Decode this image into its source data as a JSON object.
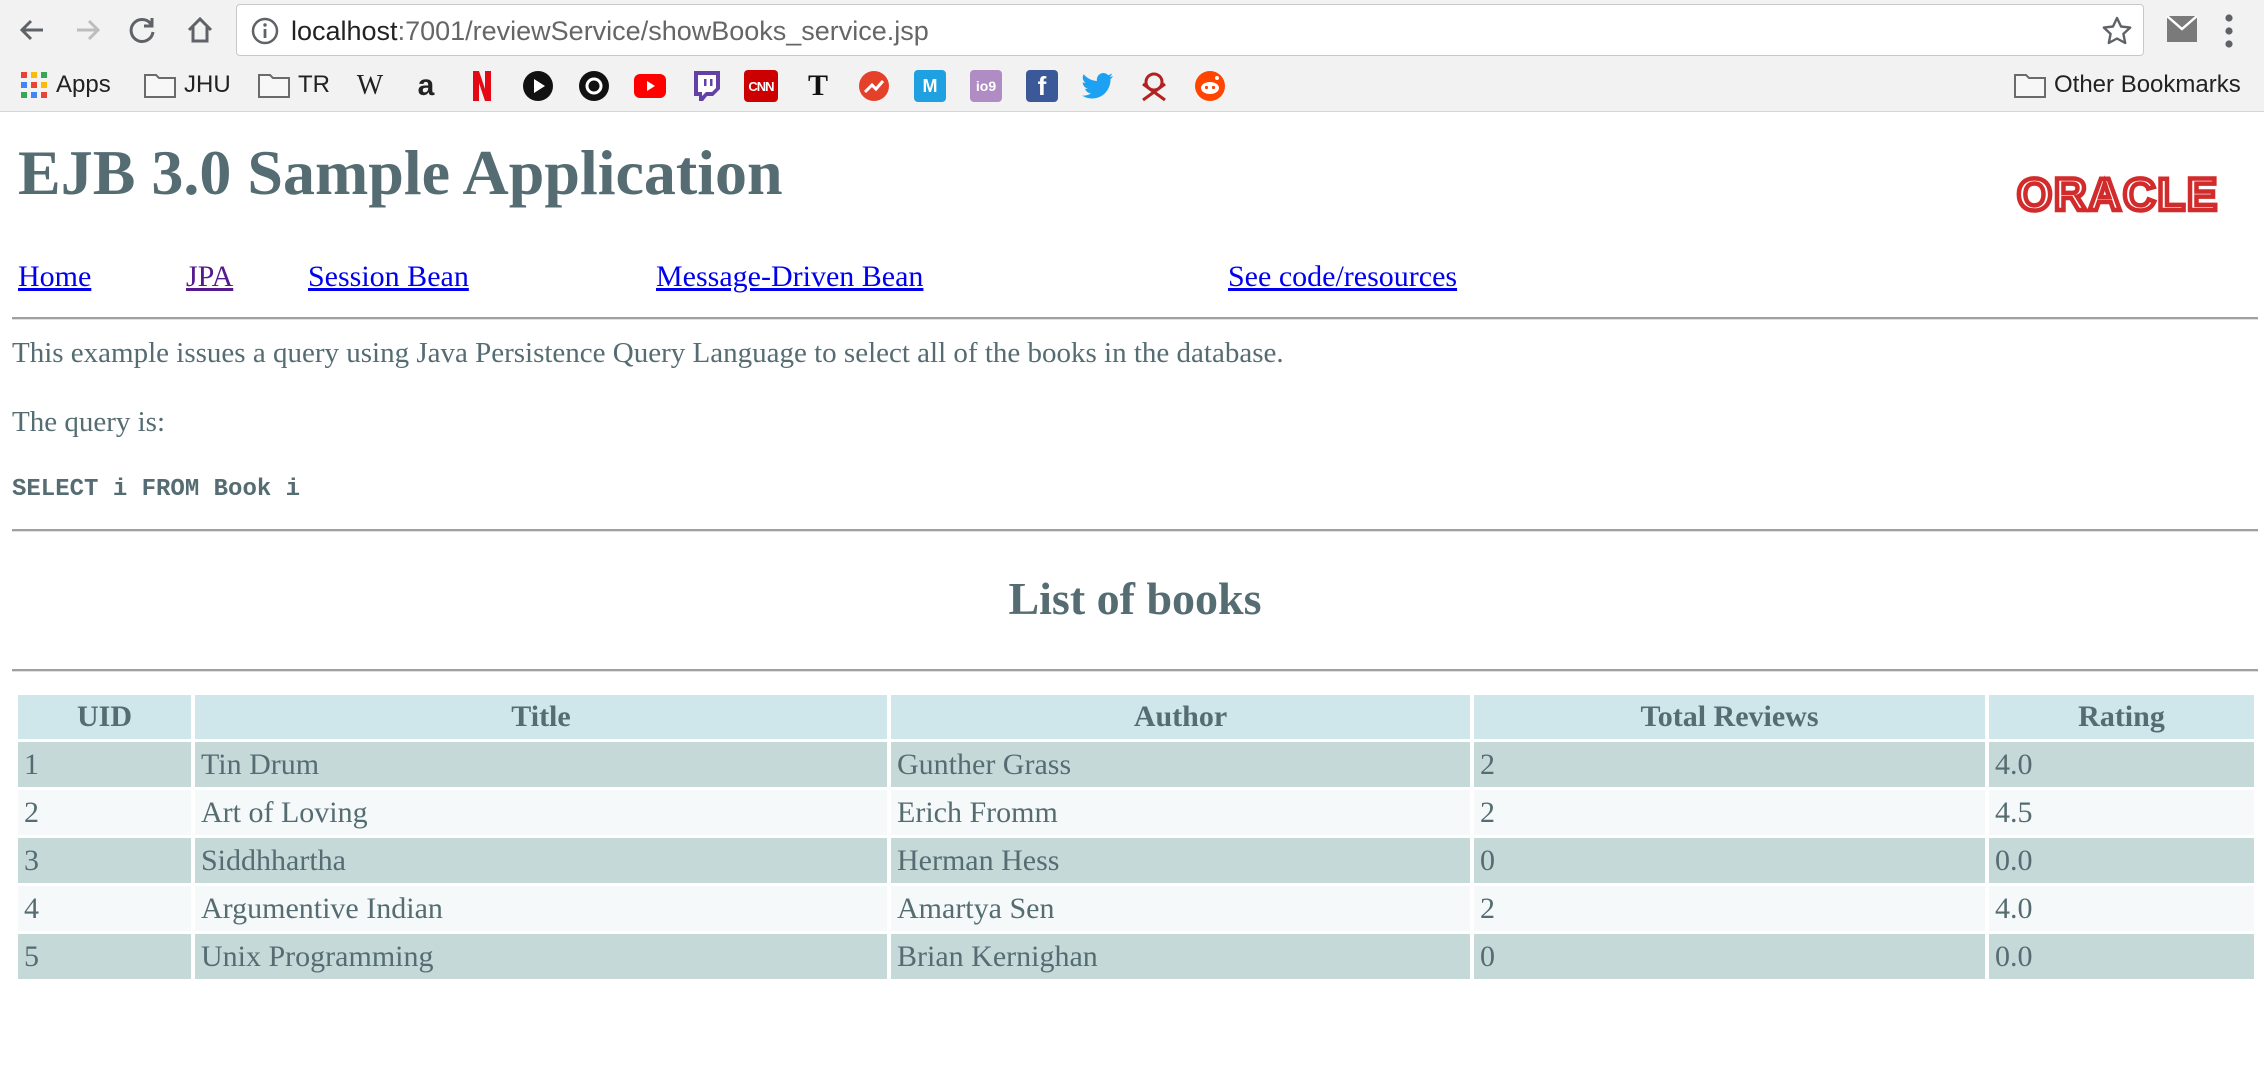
{
  "browser": {
    "url_host": "localhost",
    "url_rest": ":7001/reviewService/showBooks_service.jsp"
  },
  "bookmarks": {
    "apps": "Apps",
    "folders": [
      "JHU",
      "TR"
    ],
    "other": "Other Bookmarks"
  },
  "page": {
    "title": "EJB 3.0 Sample Application",
    "logo_text": "ORACLE",
    "nav": [
      "Home",
      "JPA",
      "Session Bean",
      "Message-Driven Bean",
      "See code/resources"
    ],
    "intro": "This example issues a query using Java Persistence Query Language to select all of the books in the database.",
    "query_label": "The query is:",
    "query": "SELECT i FROM Book i",
    "list_title": "List of books"
  },
  "table": {
    "headers": [
      "UID",
      "Title",
      "Author",
      "Total Reviews",
      "Rating"
    ],
    "rows": [
      [
        "1",
        "Tin Drum",
        "Gunther Grass",
        "2",
        "4.0"
      ],
      [
        "2",
        "Art of Loving",
        "Erich Fromm",
        "2",
        "4.5"
      ],
      [
        "3",
        "Siddhhartha",
        "Herman Hess",
        "0",
        "0.0"
      ],
      [
        "4",
        "Argumentive Indian",
        "Amartya Sen",
        "2",
        "4.0"
      ],
      [
        "5",
        "Unix Programming",
        "Brian Kernighan",
        "0",
        "0.0"
      ]
    ]
  },
  "colors": {
    "text": "#546c72",
    "header_bg": "#cfe6eb",
    "row_odd": "#c5d9d9",
    "row_even": "#f5f9f9",
    "link": "#0000ee",
    "visited_link": "#551a8b",
    "oracle_red": "#d22b2b"
  }
}
